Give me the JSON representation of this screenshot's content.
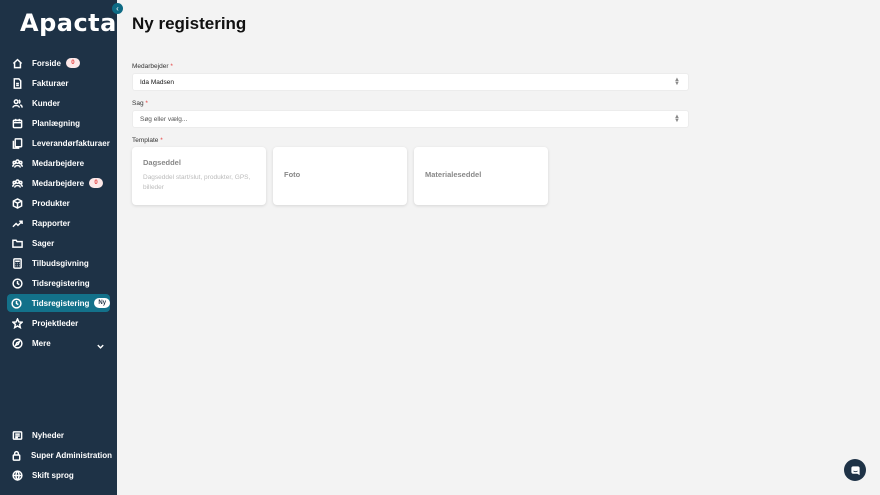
{
  "app": {
    "logo": "Apacta",
    "collapse_icon": "chevron-left-icon"
  },
  "sidebar": {
    "items": [
      {
        "label": "Forside",
        "icon": "home-icon",
        "badge": "0"
      },
      {
        "label": "Fakturaer",
        "icon": "invoice-icon"
      },
      {
        "label": "Kunder",
        "icon": "users-icon"
      },
      {
        "label": "Planlægning",
        "icon": "calendar-icon"
      },
      {
        "label": "Leverandørfakturaer",
        "icon": "documents-icon"
      },
      {
        "label": "Medarbejdere",
        "icon": "team-icon"
      },
      {
        "label": "Medarbejdere",
        "icon": "team-icon",
        "badge": "0"
      },
      {
        "label": "Produkter",
        "icon": "box-icon"
      },
      {
        "label": "Rapporter",
        "icon": "trend-icon"
      },
      {
        "label": "Sager",
        "icon": "folder-icon"
      },
      {
        "label": "Tilbudsgivning",
        "icon": "calculator-icon"
      },
      {
        "label": "Tidsregistering",
        "icon": "clock-icon"
      },
      {
        "label": "Tidsregistering",
        "icon": "clock-icon",
        "badge": "Ny",
        "active": true
      },
      {
        "label": "Projektleder",
        "icon": "star-icon"
      },
      {
        "label": "Mere",
        "icon": "compass-icon",
        "expand_icon": "chevron-down-icon"
      }
    ],
    "bottom_items": [
      {
        "label": "Nyheder",
        "icon": "news-icon"
      },
      {
        "label": "Super Administration",
        "icon": "lock-icon"
      },
      {
        "label": "Skift sprog",
        "icon": "globe-icon"
      }
    ]
  },
  "main": {
    "title": "Ny registering",
    "employee": {
      "label": "Medarbejder",
      "required": "*",
      "value": "Ida Madsen"
    },
    "case": {
      "label": "Sag",
      "required": "*",
      "placeholder": "Søg eller vælg..."
    },
    "template": {
      "label": "Template",
      "required": "*",
      "cards": [
        {
          "title": "Dagseddel",
          "description": "Dagseddel start/slut, produkter, GPS, billeder"
        },
        {
          "title": "Foto"
        },
        {
          "title": "Materialeseddel"
        }
      ]
    }
  },
  "chat": {
    "icon": "chat-icon"
  },
  "colors": {
    "sidebar": "#1e3246",
    "active": "#13718a",
    "background": "#f3f3f3",
    "badge_text": "#e53e3e"
  }
}
